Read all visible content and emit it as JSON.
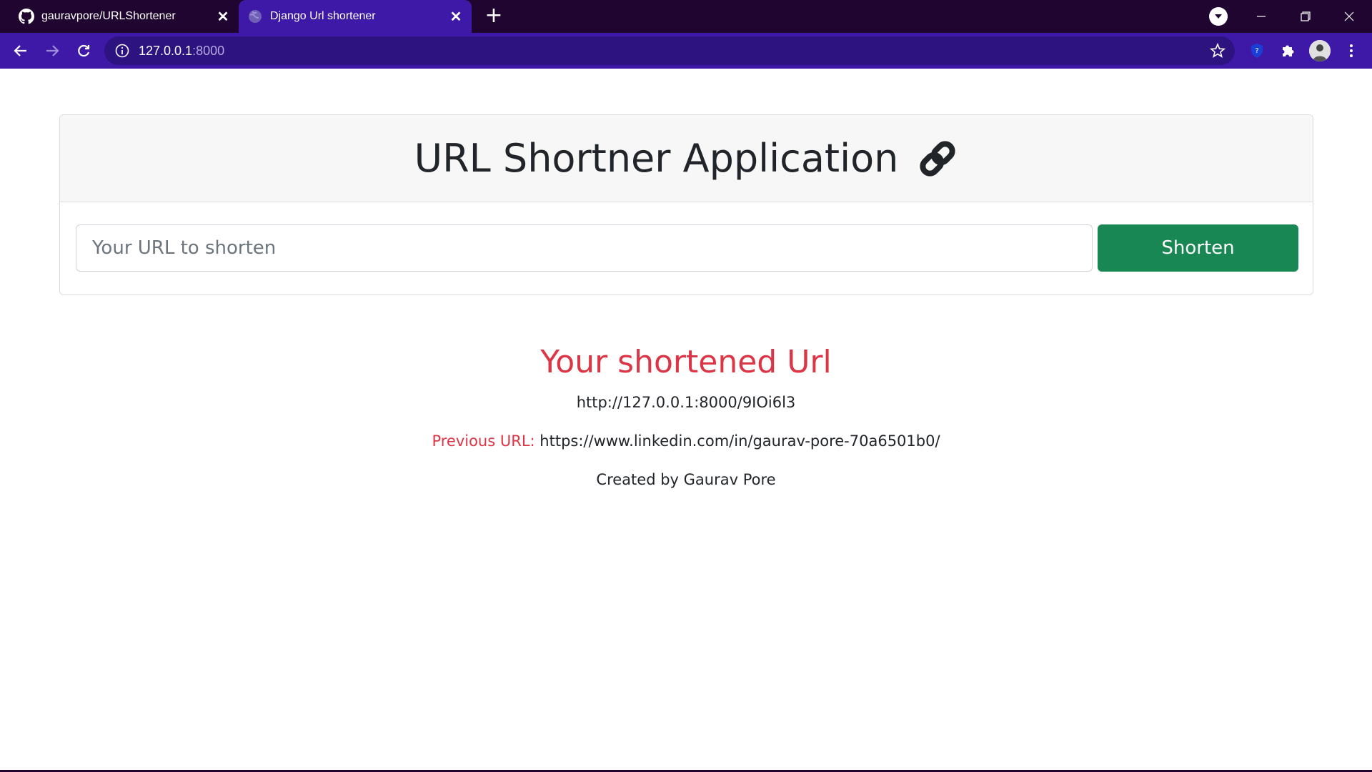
{
  "browser": {
    "tabs": [
      {
        "title": "gauravpore/URLShortener",
        "favicon": "github-icon",
        "active": false
      },
      {
        "title": "Django Url shortener",
        "favicon": "globe-icon",
        "active": true
      }
    ],
    "address": {
      "host": "127.0.0.1",
      "port": ":8000"
    },
    "colors": {
      "tabstrip": "#1f0530",
      "toolbar": "#3e19a8",
      "omnibox": "#2d1380"
    }
  },
  "app": {
    "title": "URL Shortner Application",
    "title_icon": "link-icon",
    "input_placeholder": "Your URL to shorten",
    "input_value": "",
    "button_label": "Shorten",
    "result_heading": "Your shortened Url",
    "short_url": "http://127.0.0.1:8000/9IOi6l3",
    "previous_label": "Previous URL:",
    "previous_url": "https://www.linkedin.com/in/gaurav-pore-70a6501b0/",
    "credit": "Created by Gaurav Pore",
    "colors": {
      "accent_red": "#dc3545",
      "button_green": "#198754",
      "text": "#212529"
    }
  }
}
